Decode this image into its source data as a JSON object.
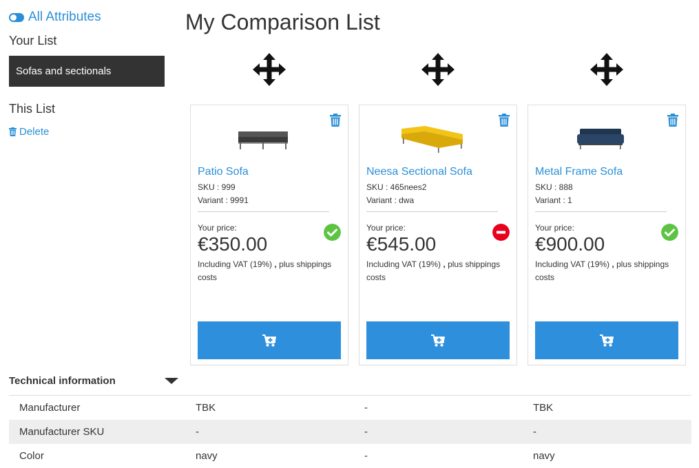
{
  "sidebar": {
    "toggle_label": "All Attributes",
    "your_list_heading": "Your List",
    "list_item": "Sofas and sectionals",
    "this_list_heading": "This List",
    "delete_label": "Delete"
  },
  "main": {
    "title": "My Comparison List"
  },
  "products": [
    {
      "name": "Patio Sofa",
      "sku": "SKU : 999",
      "variant": "Variant : 9991",
      "price_label": "Your price:",
      "price": "€350.00",
      "vat": "Including VAT (19%)",
      "shipping": "plus shippings costs",
      "stock_status": "in-stock",
      "sofa_color": "#555555"
    },
    {
      "name": "Neesa Sectional Sofa",
      "sku": "SKU : 465nees2",
      "variant": "Variant : dwa",
      "price_label": "Your price:",
      "price": "€545.00",
      "vat": "Including VAT (19%)",
      "shipping": "plus shippings costs",
      "stock_status": "out-of-stock",
      "sofa_color": "#f2c418"
    },
    {
      "name": "Metal Frame Sofa",
      "sku": "SKU : 888",
      "variant": "Variant : 1",
      "price_label": "Your price:",
      "price": "€900.00",
      "vat": "Including VAT (19%)",
      "shipping": "plus shippings costs",
      "stock_status": "in-stock",
      "sofa_color": "#1f3550"
    }
  ],
  "technical": {
    "heading": "Technical information",
    "rows": [
      {
        "label": "Manufacturer",
        "values": [
          "TBK",
          "-",
          "TBK"
        ]
      },
      {
        "label": "Manufacturer SKU",
        "values": [
          "-",
          "-",
          "-"
        ]
      },
      {
        "label": "Color",
        "values": [
          "navy",
          "-",
          "navy"
        ]
      }
    ]
  },
  "colors": {
    "accent": "#2b8fd6",
    "button": "#2e8fdc",
    "in_stock": "#5cc442",
    "out_of_stock": "#e8001c",
    "selected_bg": "#333333"
  }
}
